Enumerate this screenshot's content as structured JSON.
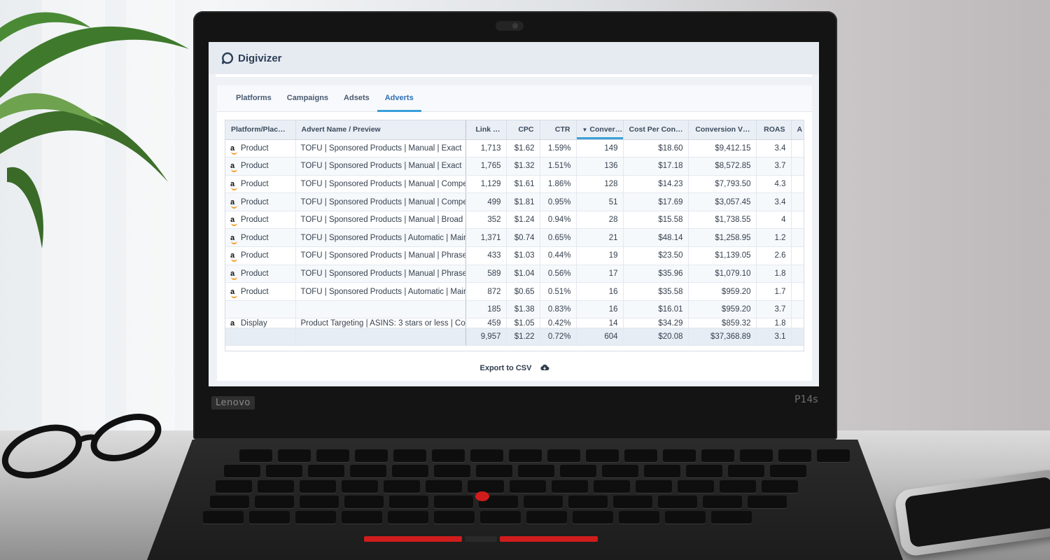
{
  "app": {
    "name": "Digivizer",
    "logo_icon": "chat-bubble-logo-icon"
  },
  "tabs": [
    {
      "label": "Platforms",
      "active": false
    },
    {
      "label": "Campaigns",
      "active": false
    },
    {
      "label": "Adsets",
      "active": false
    },
    {
      "label": "Adverts",
      "active": true
    }
  ],
  "table": {
    "columns": [
      "Platform/Plac…",
      "Advert Name / Preview",
      "Link …",
      "CPC",
      "CTR",
      "Conver…",
      "Cost Per Con…",
      "Conversion V…",
      "ROAS",
      "A"
    ],
    "sorted_column": "Conver…",
    "rows": [
      {
        "platform": "Product",
        "advert": "TOFU | Sponsored Products | Manual | Exact",
        "link": "1,713",
        "cpc": "$1.62",
        "ctr": "1.59%",
        "conv": "149",
        "cost_per_conv": "$18.60",
        "conv_value": "$9,412.15",
        "roas": "3.4"
      },
      {
        "platform": "Product",
        "advert": "TOFU | Sponsored Products | Manual | Exact",
        "link": "1,765",
        "cpc": "$1.32",
        "ctr": "1.51%",
        "conv": "136",
        "cost_per_conv": "$17.18",
        "conv_value": "$8,572.85",
        "roas": "3.7"
      },
      {
        "platform": "Product",
        "advert": "TOFU | Sponsored Products | Manual | Compe",
        "link": "1,129",
        "cpc": "$1.61",
        "ctr": "1.86%",
        "conv": "128",
        "cost_per_conv": "$14.23",
        "conv_value": "$7,793.50",
        "roas": "4.3"
      },
      {
        "platform": "Product",
        "advert": "TOFU | Sponsored Products | Manual | Compe",
        "link": "499",
        "cpc": "$1.81",
        "ctr": "0.95%",
        "conv": "51",
        "cost_per_conv": "$17.69",
        "conv_value": "$3,057.45",
        "roas": "3.4"
      },
      {
        "platform": "Product",
        "advert": "TOFU | Sponsored Products | Manual | Broad",
        "link": "352",
        "cpc": "$1.24",
        "ctr": "0.94%",
        "conv": "28",
        "cost_per_conv": "$15.58",
        "conv_value": "$1,738.55",
        "roas": "4"
      },
      {
        "platform": "Product",
        "advert": "TOFU | Sponsored Products | Automatic | Mair",
        "link": "1,371",
        "cpc": "$0.74",
        "ctr": "0.65%",
        "conv": "21",
        "cost_per_conv": "$48.14",
        "conv_value": "$1,258.95",
        "roas": "1.2"
      },
      {
        "platform": "Product",
        "advert": "TOFU | Sponsored Products | Manual | Phrase",
        "link": "433",
        "cpc": "$1.03",
        "ctr": "0.44%",
        "conv": "19",
        "cost_per_conv": "$23.50",
        "conv_value": "$1,139.05",
        "roas": "2.6"
      },
      {
        "platform": "Product",
        "advert": "TOFU | Sponsored Products | Manual | Phrase",
        "link": "589",
        "cpc": "$1.04",
        "ctr": "0.56%",
        "conv": "17",
        "cost_per_conv": "$35.96",
        "conv_value": "$1,079.10",
        "roas": "1.8"
      },
      {
        "platform": "Product",
        "advert": "TOFU | Sponsored Products | Automatic | Mair",
        "link": "872",
        "cpc": "$0.65",
        "ctr": "0.51%",
        "conv": "16",
        "cost_per_conv": "$35.58",
        "conv_value": "$959.20",
        "roas": "1.7"
      },
      {
        "platform": "",
        "advert": "",
        "link": "185",
        "cpc": "$1.38",
        "ctr": "0.83%",
        "conv": "16",
        "cost_per_conv": "$16.01",
        "conv_value": "$959.20",
        "roas": "3.7"
      }
    ],
    "partial_row": {
      "platform": "Display",
      "advert": "Product Targeting | ASINS: 3 stars or less | Con",
      "link": "459",
      "cpc": "$1.05",
      "ctr": "0.42%",
      "conv": "14",
      "cost_per_conv": "$34.29",
      "conv_value": "$859.32",
      "roas": "1.8"
    },
    "totals": {
      "link": "9,957",
      "cpc": "$1.22",
      "ctr": "0.72%",
      "conv": "604",
      "cost_per_conv": "$20.08",
      "conv_value": "$37,368.89",
      "roas": "3.1"
    }
  },
  "export": {
    "label": "Export to CSV",
    "icon": "cloud-download-icon"
  },
  "laptop": {
    "brand": "Lenovo",
    "model": "P14s"
  },
  "colors": {
    "accent": "#3aa0d8",
    "amazon_orange": "#f39a1f",
    "trackpoint": "#d21c1c"
  }
}
